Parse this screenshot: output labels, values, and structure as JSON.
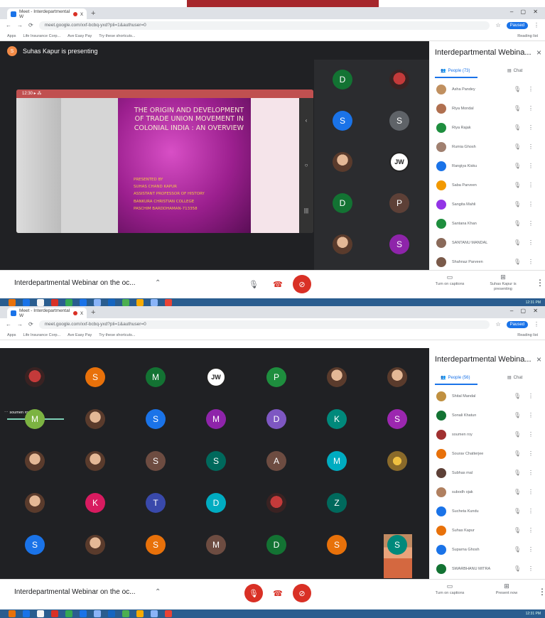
{
  "browser": {
    "tab_title": "Meet - Interdepartmental W",
    "tab_close": "x",
    "new_tab": "+",
    "window_controls": "– ▢ ✕",
    "url": "meet.google.com/xxf-bcbq-yxd?pli=1&authuser=0",
    "bookmarks": [
      "Apps",
      "Life Insurance Corp...",
      "Ave Easy Pay",
      "Try these shortcuts..."
    ],
    "reading_list": "Reading list",
    "profile_label": "Paused"
  },
  "meeting_title": "Interdepartmental Webinar on the oc...",
  "panel_title": "Interdepartmental Webina...",
  "screen1": {
    "presenting_text": "Suhas Kapur is presenting",
    "presenter_initial": "S",
    "slide": {
      "title": "THE ORIGIN AND DEVELOPMENT OF TRADE UNION MOVEMENT IN COLONIAL INDIA : AN OVERVIEW",
      "presented_by": "PRESENTED BY",
      "author_lines": [
        "SUHAS CHAND KAPUR",
        "ASSISTANT PROFESSOR OF HISTORY",
        "BANKURA CHRISTIAN COLLEGE",
        "PASCHIM BARDDHAMAN-713358"
      ]
    },
    "people_tab": "People (73)",
    "chat_tab": "Chat",
    "participants": [
      {
        "name": "Asha Pandey",
        "color": "#c09060"
      },
      {
        "name": "Riya Mondal",
        "color": "#b07050"
      },
      {
        "name": "Riya Rajak",
        "color": "#1e8e3e"
      },
      {
        "name": "Rumia Ghosh",
        "color": "#a08070"
      },
      {
        "name": "Rangiya Kisku",
        "color": "#1a73e8"
      },
      {
        "name": "Saba Parveen",
        "color": "#f29900"
      },
      {
        "name": "Sangita Mahli",
        "color": "#9334e6"
      },
      {
        "name": "Santana Khan",
        "color": "#1e8e3e"
      },
      {
        "name": "SANTANU MANDAL",
        "color": "#8a6a5a"
      },
      {
        "name": "Shahnaz Parveen",
        "color": "#7a5a4a"
      }
    ],
    "grid_tiles": [
      {
        "letter": "D",
        "color": "#137333"
      },
      {
        "letter": "",
        "color": "red"
      },
      {
        "letter": "S",
        "color": "#1a73e8"
      },
      {
        "letter": "S",
        "color": "#5f6368"
      },
      {
        "letter": "",
        "color": "photo"
      },
      {
        "letter": "JW",
        "color": "jw"
      },
      {
        "letter": "D",
        "color": "#137333"
      },
      {
        "letter": "P",
        "color": "#5d4037"
      },
      {
        "letter": "",
        "color": "photo"
      },
      {
        "letter": "S",
        "color": "#8e24aa"
      }
    ],
    "captions_label": "Turn on captions",
    "present_label": "Suhas Kapur is presenting"
  },
  "screen2": {
    "people_tab": "People (56)",
    "chat_tab": "Chat",
    "active_speaker": "soumen roy",
    "participants": [
      {
        "name": "Shital Mandal",
        "color": "#c09040"
      },
      {
        "name": "Sonali Khatun",
        "color": "#137333"
      },
      {
        "name": "soumen roy",
        "color": "#a03030"
      },
      {
        "name": "Sourav Chatterjee",
        "color": "#e8710a"
      },
      {
        "name": "Subhas mal",
        "color": "#5d4037"
      },
      {
        "name": "subodh ojak",
        "color": "#b08060"
      },
      {
        "name": "Sucheta Kundu",
        "color": "#1a73e8"
      },
      {
        "name": "Suhas Kapur",
        "color": "#e8710a"
      },
      {
        "name": "Suparna Ghosh",
        "color": "#1a73e8"
      },
      {
        "name": "SWARBHANU MITRA",
        "color": "#137333"
      }
    ],
    "grid_rows": [
      [
        {
          "l": "",
          "c": "red"
        },
        {
          "l": "S",
          "c": "#e8710a"
        },
        {
          "l": "M",
          "c": "#137333"
        },
        {
          "l": "JW",
          "c": "jw"
        },
        {
          "l": "P",
          "c": "#1e8e3e"
        },
        {
          "l": "",
          "c": "photo"
        },
        {
          "l": "",
          "c": "photo"
        }
      ],
      [
        {
          "l": "M",
          "c": "#7cb342"
        },
        {
          "l": "",
          "c": "photo"
        },
        {
          "l": "S",
          "c": "#1a73e8"
        },
        {
          "l": "M",
          "c": "#8e24aa"
        },
        {
          "l": "D",
          "c": "#7e57c2"
        },
        {
          "l": "K",
          "c": "#00897b"
        },
        {
          "l": "S",
          "c": "#9c27b0"
        }
      ],
      [
        {
          "l": "",
          "c": "photo"
        },
        {
          "l": "",
          "c": "photo"
        },
        {
          "l": "S",
          "c": "#6d4c41"
        },
        {
          "l": "S",
          "c": "#00695c"
        },
        {
          "l": "A",
          "c": "#6d4c41"
        },
        {
          "l": "M",
          "c": "#00acc1"
        },
        {
          "l": "",
          "c": "flower"
        }
      ],
      [
        {
          "l": "",
          "c": "photo"
        },
        {
          "l": "K",
          "c": "#d81b60"
        },
        {
          "l": "T",
          "c": "#3949ab"
        },
        {
          "l": "D",
          "c": "#00acc1"
        },
        {
          "l": "",
          "c": "red"
        },
        {
          "l": "Z",
          "c": "#00695c"
        },
        {
          "l": "",
          "c": "thumb"
        }
      ],
      [
        {
          "l": "S",
          "c": "#1a73e8"
        },
        {
          "l": "",
          "c": "photo"
        },
        {
          "l": "S",
          "c": "#e8710a"
        },
        {
          "l": "M",
          "c": "#6d4c41"
        },
        {
          "l": "D",
          "c": "#137333"
        },
        {
          "l": "S",
          "c": "#e8710a"
        },
        {
          "l": "S",
          "c": "#00897b"
        }
      ]
    ],
    "captions_label": "Turn on captions",
    "present_label": "Present now"
  },
  "taskbar_time": "12:31 PM"
}
